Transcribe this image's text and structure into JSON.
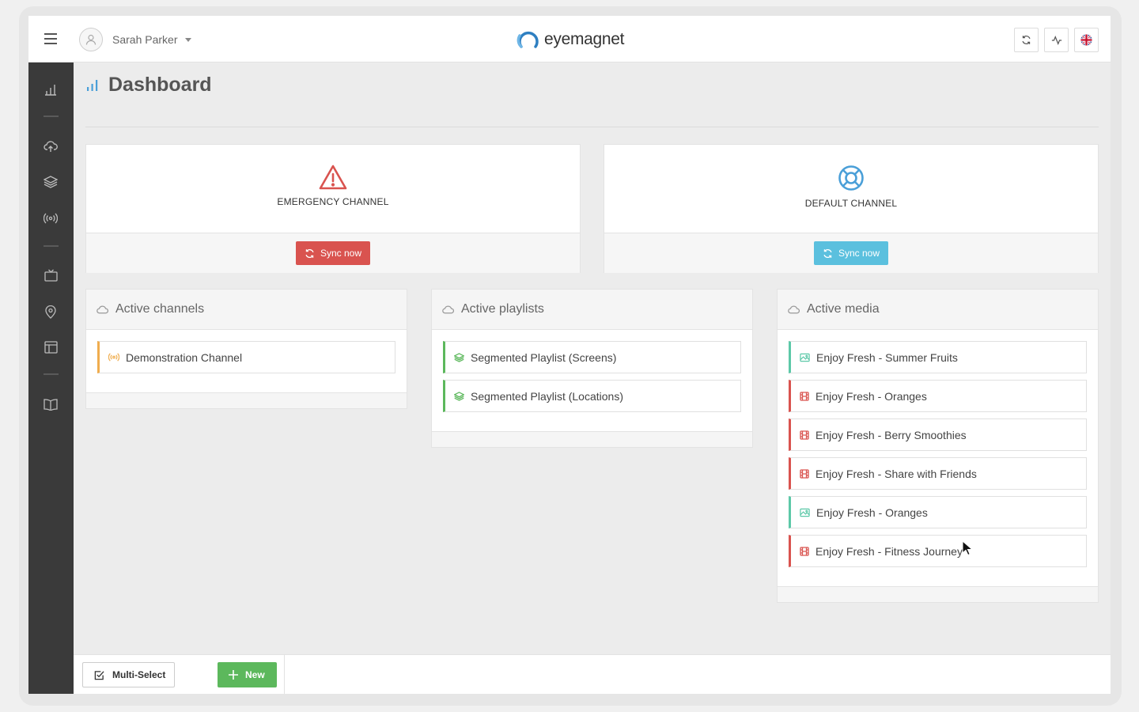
{
  "header": {
    "user_name": "Sarah Parker",
    "logo_text": "eyemagnet"
  },
  "sidebar": {
    "icons": [
      "bar-chart-icon",
      "cloud-upload-icon",
      "layers-icon",
      "broadcast-icon",
      "tv-icon",
      "map-pin-icon",
      "layout-icon",
      "book-icon"
    ]
  },
  "page": {
    "title": "Dashboard"
  },
  "channels": {
    "emergency": {
      "label": "EMERGENCY CHANNEL",
      "button": "Sync now",
      "color": "#d9534f"
    },
    "default": {
      "label": "DEFAULT CHANNEL",
      "button": "Sync now",
      "color": "#5bc0de"
    }
  },
  "panels": {
    "channels": {
      "title": "Active channels",
      "items": [
        {
          "label": "Demonstration Channel",
          "icon": "broadcast-icon"
        }
      ]
    },
    "playlists": {
      "title": "Active playlists",
      "items": [
        {
          "label": "Segmented Playlist (Screens)",
          "icon": "layers-icon"
        },
        {
          "label": "Segmented Playlist (Locations)",
          "icon": "layers-icon"
        }
      ]
    },
    "media": {
      "title": "Active media",
      "items": [
        {
          "label": "Enjoy Fresh - Summer Fruits",
          "icon": "image-icon"
        },
        {
          "label": "Enjoy Fresh - Oranges",
          "icon": "film-icon"
        },
        {
          "label": "Enjoy Fresh - Berry Smoothies",
          "icon": "film-icon"
        },
        {
          "label": "Enjoy Fresh - Share with Friends",
          "icon": "film-icon"
        },
        {
          "label": "Enjoy Fresh - Oranges",
          "icon": "image-icon"
        },
        {
          "label": "Enjoy Fresh - Fitness Journey",
          "icon": "film-icon"
        }
      ]
    }
  },
  "bottombar": {
    "multi_select": "Multi-Select",
    "new": "New"
  }
}
